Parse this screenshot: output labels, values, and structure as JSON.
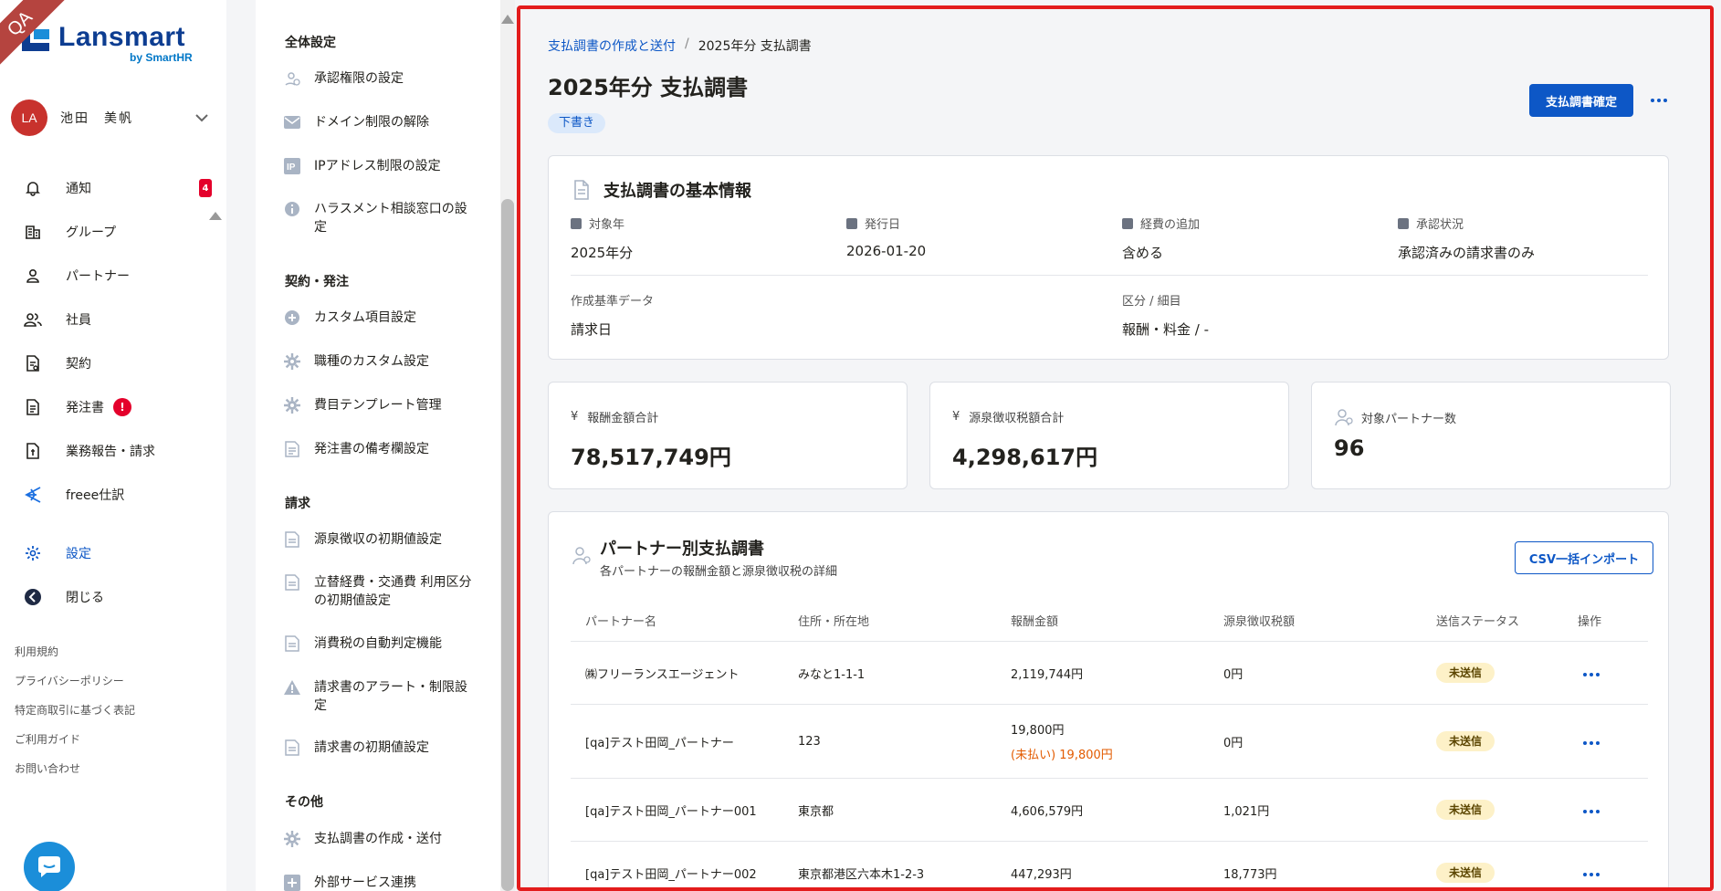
{
  "brand": {
    "ribbon": "QA",
    "name": "Lansmart",
    "sub": "by SmartHR"
  },
  "user": {
    "initials": "LA",
    "name": "池田　美帆"
  },
  "nav": {
    "items": [
      {
        "label": "通知",
        "count": "4"
      },
      {
        "label": "グループ"
      },
      {
        "label": "パートナー"
      },
      {
        "label": "社員"
      },
      {
        "label": "契約"
      },
      {
        "label": "発注書",
        "alert": "!"
      },
      {
        "label": "業務報告・請求"
      },
      {
        "label": "freee仕訳"
      },
      {
        "label": "設定"
      },
      {
        "label": "閉じる"
      }
    ],
    "footer": [
      "利用規約",
      "プライバシーポリシー",
      "特定商取引に基づく表記",
      "ご利用ガイド",
      "お問い合わせ"
    ]
  },
  "subnav": {
    "sections": [
      {
        "title": "全体設定",
        "items": [
          "承認権限の設定",
          "ドメイン制限の解除",
          "IPアドレス制限の設定",
          "ハラスメント相談窓口の設定"
        ]
      },
      {
        "title": "契約・発注",
        "items": [
          "カスタム項目設定",
          "職種のカスタム設定",
          "費目テンプレート管理",
          "発注書の備考欄設定"
        ]
      },
      {
        "title": "請求",
        "items": [
          "源泉徴収の初期値設定",
          "立替経費・交通費 利用区分の初期値設定",
          "消費税の自動判定機能",
          "請求書のアラート・制限設定",
          "請求書の初期値設定"
        ]
      },
      {
        "title": "その他",
        "items": [
          "支払調書の作成・送付",
          "外部サービス連携"
        ]
      }
    ]
  },
  "main": {
    "breadcrumb": {
      "parent": "支払調書の作成と送付",
      "current": "2025年分 支払調書"
    },
    "title": "2025年分 支払調書",
    "status": "下書き",
    "confirm_button": "支払調書確定",
    "basic": {
      "heading": "支払調書の基本情報",
      "fields": [
        {
          "label": "対象年",
          "value": "2025年分"
        },
        {
          "label": "発行日",
          "value": "2026-01-20"
        },
        {
          "label": "経費の追加",
          "value": "含める"
        },
        {
          "label": "承認状況",
          "value": "承認済みの請求書のみ"
        }
      ],
      "extra": [
        {
          "label": "作成基準データ",
          "value": "請求日"
        },
        {
          "label": "区分 / 細目",
          "value": "報酬・料金 / -"
        }
      ]
    },
    "stats": [
      {
        "icon": "¥",
        "label": "報酬金額合計",
        "value": "78,517,749円"
      },
      {
        "icon": "¥",
        "label": "源泉徴収税額合計",
        "value": "4,298,617円"
      },
      {
        "label": "対象パートナー数",
        "value": "96"
      }
    ],
    "partners": {
      "title": "パートナー別支払調書",
      "subtitle": "各パートナーの報酬金額と源泉徴収税の詳細",
      "import_button": "CSV一括インポート",
      "columns": [
        "パートナー名",
        "住所・所在地",
        "報酬金額",
        "源泉徴収税額",
        "送信ステータス",
        "操作"
      ],
      "rows": [
        {
          "name": "㈱フリーランスエージェント",
          "address": "みなと1-1-1",
          "amount": "2,119,744円",
          "unpaid": "",
          "tax": "0円",
          "status": "未送信"
        },
        {
          "name": "[qa]テスト田岡_パートナー",
          "address": "123",
          "amount": "19,800円",
          "unpaid": "(未払い) 19,800円",
          "tax": "0円",
          "status": "未送信"
        },
        {
          "name": "[qa]テスト田岡_パートナー001",
          "address": "東京都",
          "amount": "4,606,579円",
          "unpaid": "",
          "tax": "1,021円",
          "status": "未送信"
        },
        {
          "name": "[qa]テスト田岡_パートナー002",
          "address": "東京都港区六本木1-2-3",
          "amount": "447,293円",
          "unpaid": "",
          "tax": "18,773円",
          "status": "未送信"
        }
      ]
    }
  },
  "colors": {
    "accent": "#0d57c6",
    "danger": "#e4002b",
    "frame": "#e31c1c",
    "warning_bg": "#fdf1c8"
  }
}
